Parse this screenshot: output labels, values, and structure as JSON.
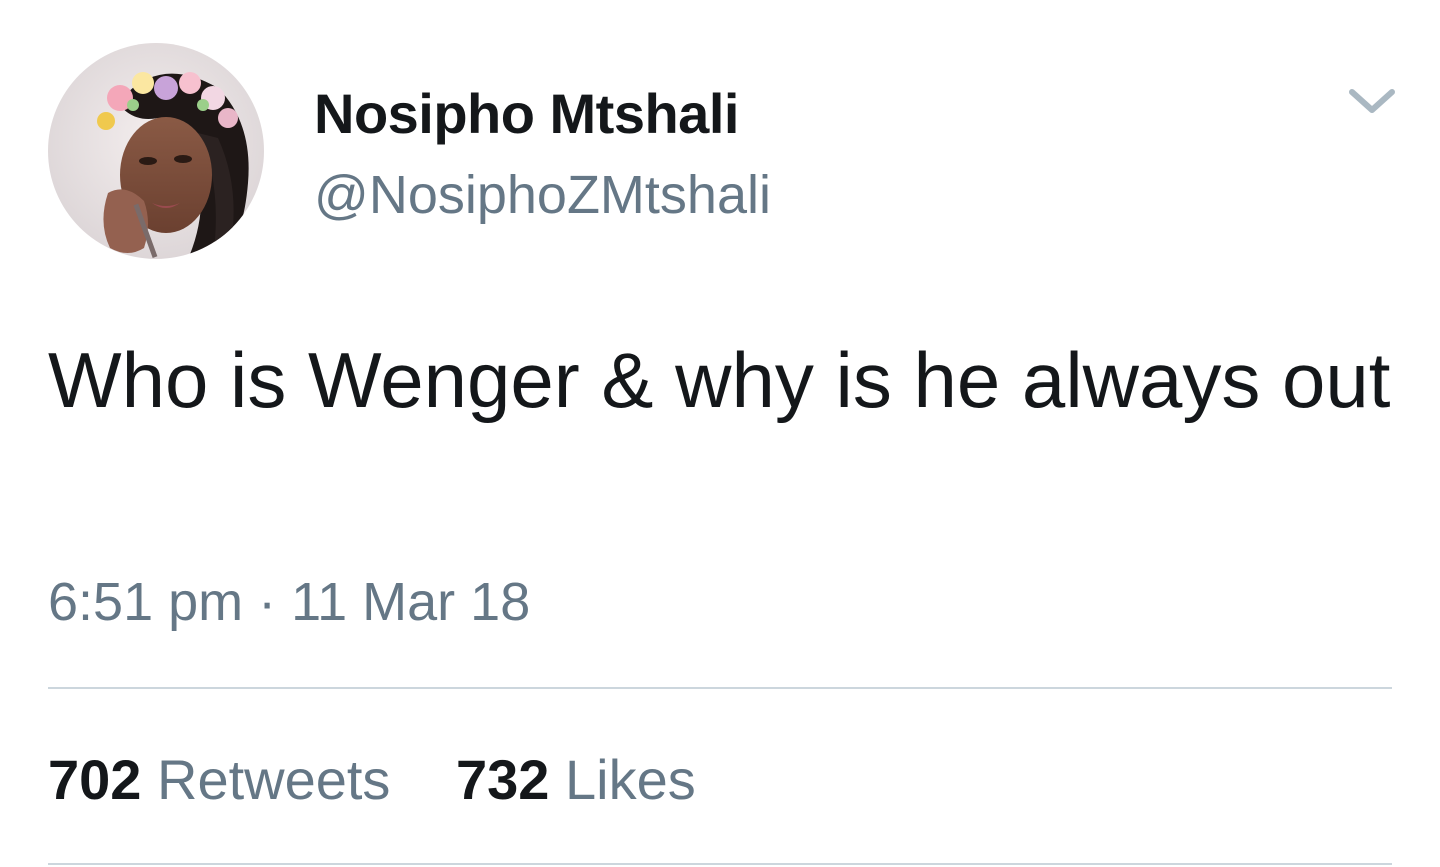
{
  "tweet": {
    "display_name": "Nosipho Mtshali",
    "handle": "@NosiphoZMtshali",
    "text": "Who is Wenger & why is he always out",
    "timestamp": "6:51 pm · 11 Mar 18",
    "avatar_icon": "profile-photo",
    "menu_icon": "chevron-down-icon"
  },
  "stats": {
    "retweets_count": "702",
    "retweets_label": "Retweets",
    "likes_count": "732",
    "likes_label": "Likes"
  },
  "colors": {
    "text_primary": "#14171a",
    "text_secondary": "#657786",
    "divider": "#ccd6dd",
    "caret": "#aab8c2"
  }
}
